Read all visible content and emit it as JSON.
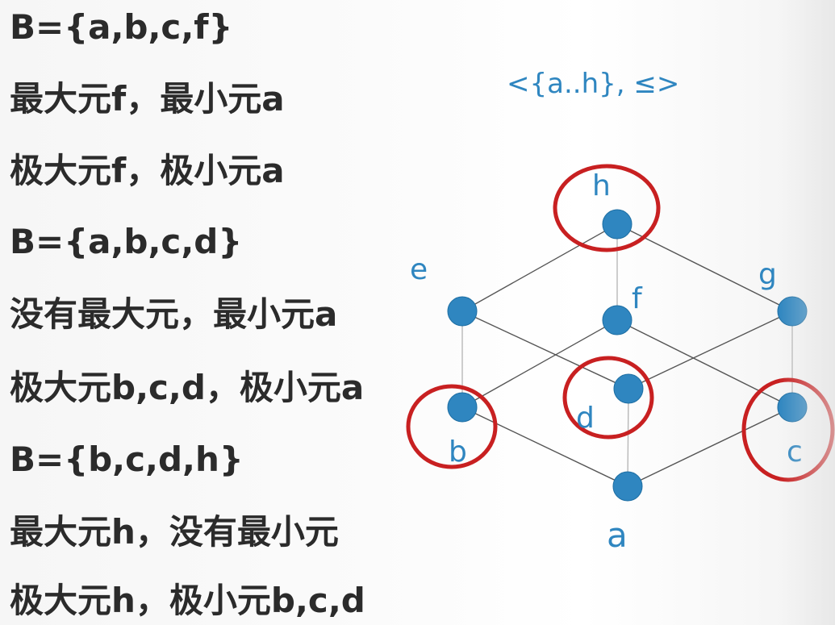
{
  "slide": {
    "lines": [
      "B={a,b,c,f}",
      "最大元f，最小元a",
      "极大元f，极小元a",
      "B={a,b,c,d}",
      "没有最大元，最小元a",
      "极大元b,c,d，极小元a",
      "B={b,c,d,h}",
      "最大元h，没有最小元",
      "极大元h，极小元b,c,d"
    ]
  },
  "diagram": {
    "title": "<{a..h}, ≤>",
    "nodes": [
      {
        "id": "h",
        "label": "h",
        "circled": true
      },
      {
        "id": "e",
        "label": "e",
        "circled": false
      },
      {
        "id": "f",
        "label": "f",
        "circled": false
      },
      {
        "id": "g",
        "label": "g",
        "circled": false
      },
      {
        "id": "b",
        "label": "b",
        "circled": true
      },
      {
        "id": "d",
        "label": "d",
        "circled": true
      },
      {
        "id": "c",
        "label": "c",
        "circled": true
      },
      {
        "id": "a",
        "label": "a",
        "circled": false
      }
    ],
    "edges": [
      [
        "h",
        "e"
      ],
      [
        "h",
        "f"
      ],
      [
        "h",
        "g"
      ],
      [
        "e",
        "b"
      ],
      [
        "e",
        "d"
      ],
      [
        "f",
        "b"
      ],
      [
        "f",
        "c"
      ],
      [
        "g",
        "d"
      ],
      [
        "g",
        "c"
      ],
      [
        "b",
        "a"
      ],
      [
        "d",
        "a"
      ],
      [
        "c",
        "a"
      ]
    ],
    "colors": {
      "node": "#2f86c0",
      "label": "#2f86c0",
      "highlight": "#c82021",
      "text": "#2b2b2b"
    }
  }
}
